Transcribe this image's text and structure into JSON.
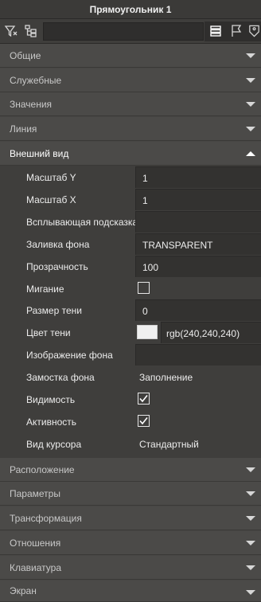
{
  "window": {
    "title": "Прямоугольник 1"
  },
  "toolbar": {
    "buttons": [
      "filter-icon",
      "tree-icon",
      "list-icon",
      "flag-icon",
      "tag-icon"
    ],
    "search_value": ""
  },
  "sections": [
    {
      "label": "Общие",
      "expanded": false
    },
    {
      "label": "Служебные",
      "expanded": false
    },
    {
      "label": "Значения",
      "expanded": false
    },
    {
      "label": "Линия",
      "expanded": false
    },
    {
      "label": "Внешний вид",
      "expanded": true
    },
    {
      "label": "Расположение",
      "expanded": false
    },
    {
      "label": "Параметры",
      "expanded": false
    },
    {
      "label": "Трансформация",
      "expanded": false
    },
    {
      "label": "Отношения",
      "expanded": false
    },
    {
      "label": "Клавиатура",
      "expanded": false
    },
    {
      "label": "Экран",
      "expanded": false
    }
  ],
  "appearance": {
    "scale_y": {
      "label": "Масштаб Y",
      "value": "1"
    },
    "scale_x": {
      "label": "Масштаб X",
      "value": "1"
    },
    "tooltip": {
      "label": "Всплывающая подсказка",
      "value": ""
    },
    "fill": {
      "label": "Заливка фона",
      "value": "TRANSPARENT"
    },
    "opacity": {
      "label": "Прозрачность",
      "value": "100"
    },
    "blink": {
      "label": "Мигание",
      "checked": false
    },
    "shadow_size": {
      "label": "Размер тени",
      "value": "0"
    },
    "shadow_color": {
      "label": "Цвет тени",
      "value": "rgb(240,240,240)",
      "swatch": "#f0f0f0"
    },
    "bg_image": {
      "label": "Изображение фона",
      "value": ""
    },
    "bg_tiling": {
      "label": "Замостка фона",
      "value": "Заполнение"
    },
    "visible": {
      "label": "Видимость",
      "checked": true
    },
    "active": {
      "label": "Активность",
      "checked": true
    },
    "cursor": {
      "label": "Вид курсора",
      "value": "Стандартный"
    }
  }
}
